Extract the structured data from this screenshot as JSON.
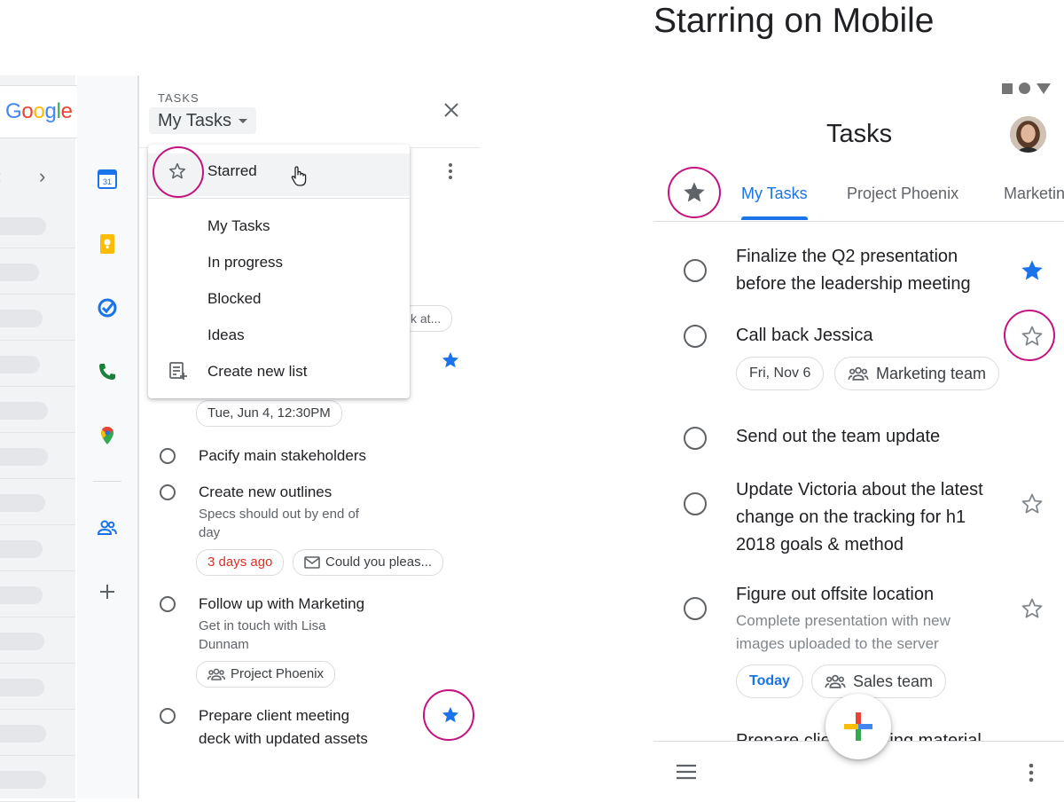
{
  "mobile_heading": "Starring on Mobile",
  "desktop": {
    "logo": "Google",
    "tasks_label": "TASKS",
    "list_selector": "My Tasks",
    "dropdown": {
      "starred": "Starred",
      "items": [
        "My Tasks",
        "In progress",
        "Blocked",
        "Ideas"
      ],
      "create": "Create new list"
    },
    "faded_chip": "k at...",
    "date_chip": "Tue, Jun 4, 12:30PM",
    "tasks": [
      {
        "title": "Pacify main stakeholders"
      },
      {
        "title": "Create new outlines",
        "sub": [
          "Specs should out by end of",
          "day"
        ],
        "chip_due": "3 days ago",
        "chip_mail": "Could you pleas..."
      },
      {
        "title": "Follow up with Marketing",
        "sub": [
          "Get in touch with Lisa",
          "Dunnam"
        ],
        "chip_group": "Project Phoenix"
      },
      {
        "title": [
          "Prepare client meeting",
          "deck with updated assets"
        ]
      }
    ],
    "colors": {
      "accent": "#1a73e8",
      "highlight_ring": "#c4127f",
      "due_red": "#d93025"
    }
  },
  "mobile": {
    "app_title": "Tasks",
    "tabs": [
      "My Tasks",
      "Project Phoenix",
      "Marketin"
    ],
    "tasks": [
      {
        "title": [
          "Finalize the Q2 presentation",
          "before the leadership meeting"
        ],
        "starred": true
      },
      {
        "title": [
          "Call back Jessica"
        ],
        "starred": false,
        "chip_date": "Fri, Nov 6",
        "chip_group": "Marketing team"
      },
      {
        "title": [
          "Send out the team update"
        ]
      },
      {
        "title": [
          "Update Victoria about the latest",
          "change on the tracking for h1",
          "2018 goals & method"
        ],
        "starred": false
      },
      {
        "title": [
          "Figure out offsite location"
        ],
        "sub": [
          "Complete presentation with new",
          "images uploaded to the server"
        ],
        "starred": false,
        "chip_date": "Today",
        "chip_group": "Sales team"
      }
    ],
    "peek_text": "Prepare client meeting material"
  }
}
